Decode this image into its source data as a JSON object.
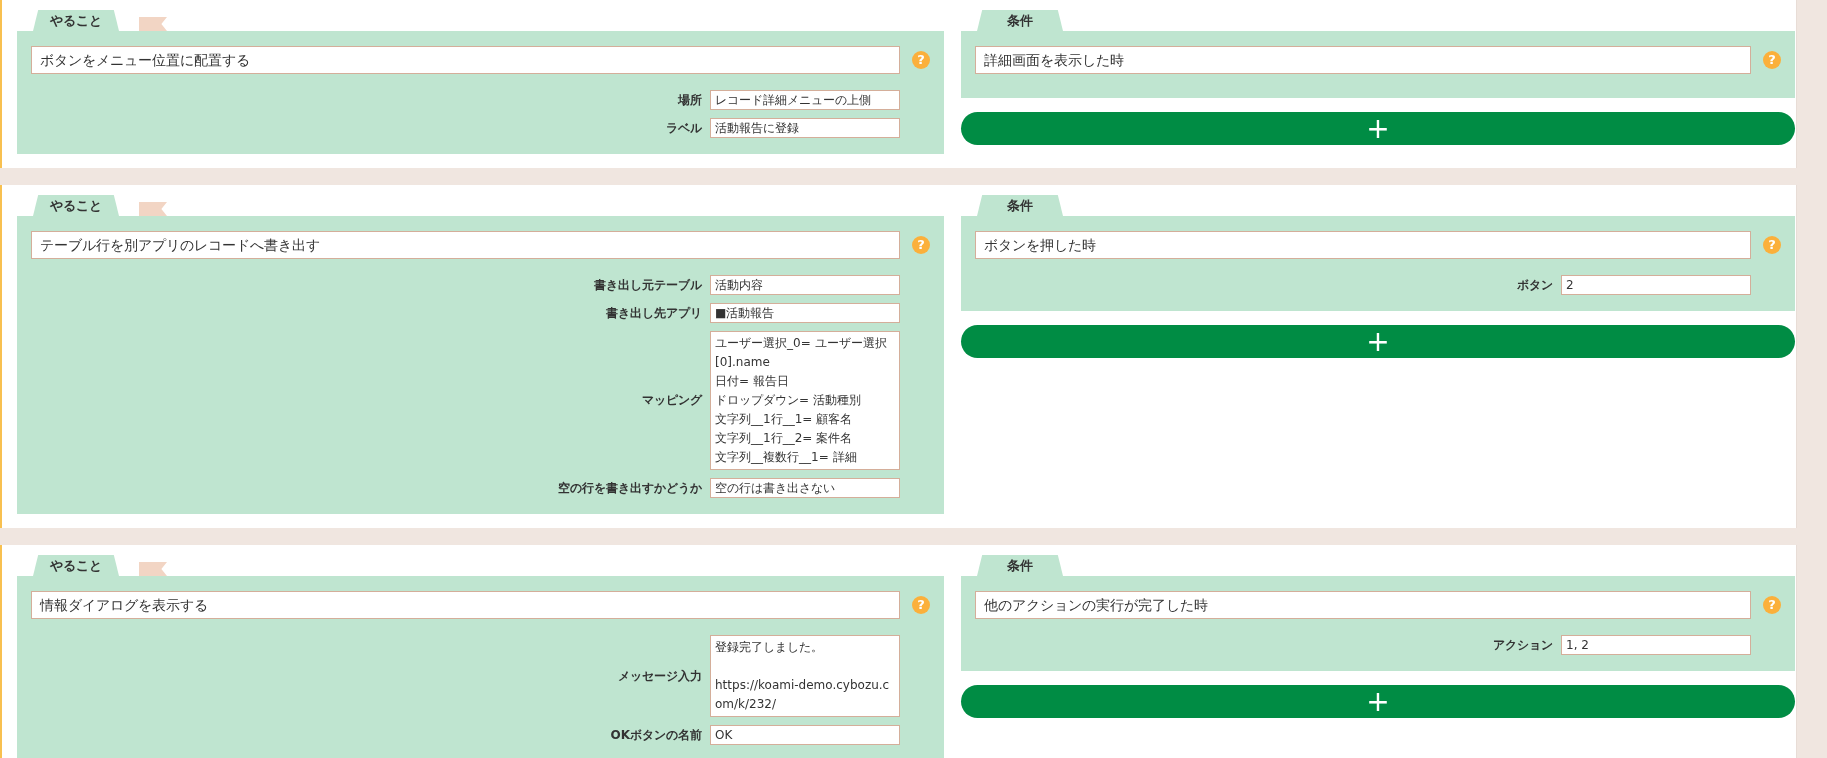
{
  "rules": [
    {
      "action": {
        "tab": "やること",
        "title": "ボタンをメニュー位置に配置する",
        "help": "?",
        "fields": [
          {
            "kind": "line",
            "label": "場所",
            "value": "レコード詳細メニューの上側"
          },
          {
            "kind": "line",
            "label": "ラベル",
            "value": "活動報告に登録"
          }
        ]
      },
      "condition": {
        "tab": "条件",
        "title": "詳細画面を表示した時",
        "help": "?"
      },
      "add_button": "+"
    },
    {
      "action": {
        "tab": "やること",
        "title": "テーブル行を別アプリのレコードへ書き出す",
        "help": "?",
        "fields": [
          {
            "kind": "line",
            "label": "書き出し元テーブル",
            "value": "活動内容"
          },
          {
            "kind": "line",
            "label": "書き出し先アプリ",
            "value": "■活動報告"
          },
          {
            "kind": "list",
            "label": "マッピング",
            "lines": [
              "ユーザー選択_0= ユーザー選択[0].name",
              "日付= 報告日",
              "ドロップダウン= 活動種別",
              "文字列__1行__1= 顧客名",
              "文字列__1行__2= 案件名",
              "文字列__複数行__1= 詳細"
            ]
          },
          {
            "kind": "line",
            "label": "空の行を書き出すかどうか",
            "value": "空の行は書き出さない"
          }
        ]
      },
      "condition": {
        "tab": "条件",
        "title": "ボタンを押した時",
        "help": "?",
        "fields": [
          {
            "kind": "line",
            "label": "ボタン",
            "value": "2"
          }
        ]
      },
      "add_button": "+"
    },
    {
      "action": {
        "tab": "やること",
        "title": "情報ダイアログを表示する",
        "help": "?",
        "fields": [
          {
            "kind": "message",
            "label": "メッセージ入力",
            "lines": [
              "登録完了しました。",
              "https://koami-demo.cybozu.com/k/232/"
            ]
          },
          {
            "kind": "line",
            "label": "OKボタンの名前",
            "value": "OK"
          }
        ]
      },
      "condition": {
        "tab": "条件",
        "title": "他のアクションの実行が完了した時",
        "help": "?",
        "fields": [
          {
            "kind": "line",
            "label": "アクション",
            "value": "1, 2"
          }
        ]
      },
      "add_button": "+"
    }
  ]
}
